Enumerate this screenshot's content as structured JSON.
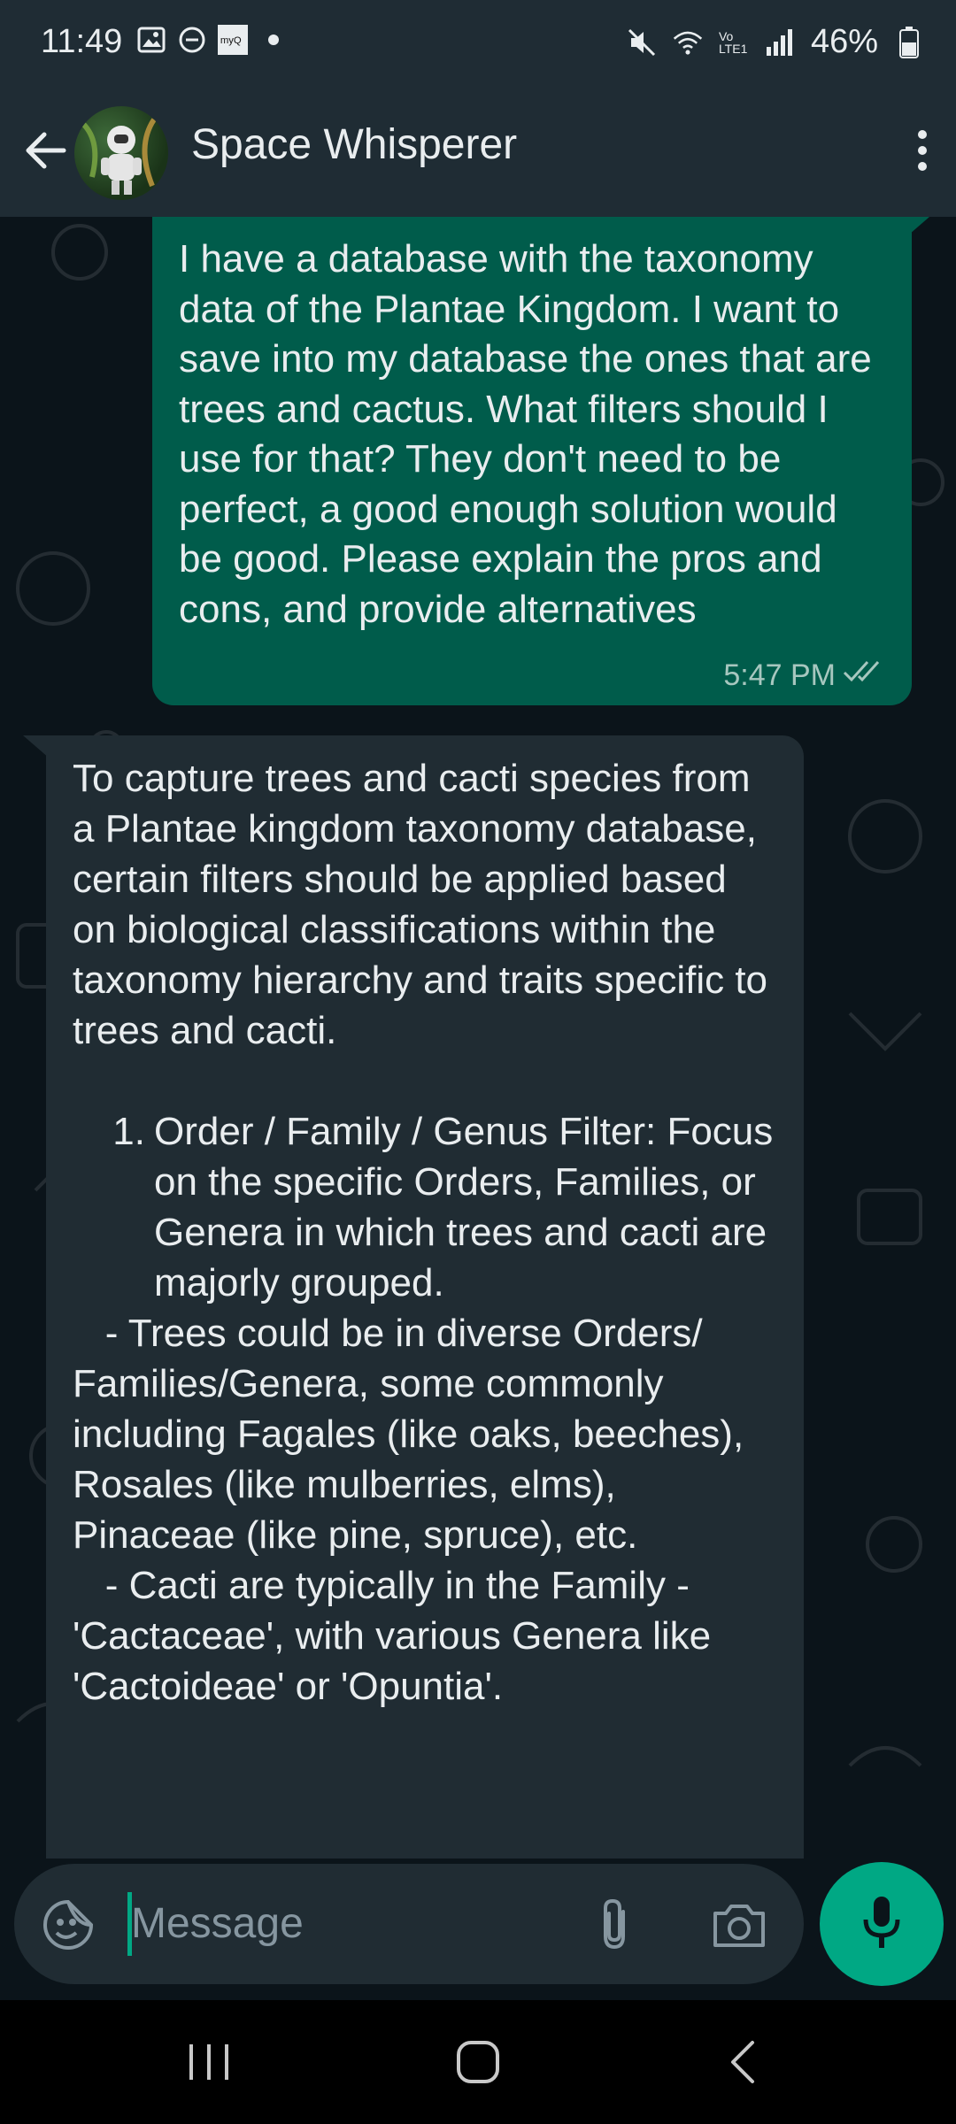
{
  "status_bar": {
    "time": "11:49",
    "network_label": "Vo LTE1",
    "battery_percent": "46%"
  },
  "header": {
    "contact_name": "Space Whisperer"
  },
  "messages": [
    {
      "direction": "outgoing",
      "text": "I have a database with the taxonomy data of the Plantae Kingdom. I want to save into my database the ones that are trees and cactus. What filters should I use for that? They don't need to be perfect, a good enough solution would be good. Please explain the pros and cons, and provide alternatives",
      "time": "5:47 PM",
      "status": "read"
    },
    {
      "direction": "incoming",
      "intro": "To capture trees and cacti species from a Plantae kingdom taxonomy database, certain filters should be applied based on biological classifications within the taxonomy hierarchy and traits specific to trees and cacti.",
      "list": [
        {
          "number": "1.",
          "text": "Order / Family / Genus Filter: Focus on the specific Orders, Families, or Genera in which trees and cacti are majorly grouped."
        }
      ],
      "bullets": [
        "   - Trees could be in diverse Orders/ Families/Genera, some commonly including Fagales (like oaks, beeches), Rosales (like mulberries, elms), Pinaceae (like pine, spruce), etc.",
        "   - Cacti are typically in the Family - 'Cactaceae', with various Genera like 'Cactoideae' or 'Opuntia'."
      ]
    }
  ],
  "composer": {
    "placeholder": "Message"
  },
  "colors": {
    "outgoing_bubble": "#005c4b",
    "incoming_bubble": "#202c33",
    "background": "#0b141a",
    "header": "#1f2c34",
    "accent": "#00a884",
    "read_ticks": "#a7c7bf"
  },
  "icons": {
    "back": "arrow-left-icon",
    "menu": "more-vertical-icon",
    "emoji": "sticker-icon",
    "attach": "paperclip-icon",
    "camera": "camera-icon",
    "mic": "microphone-icon",
    "scroll": "double-chevron-down-icon"
  }
}
